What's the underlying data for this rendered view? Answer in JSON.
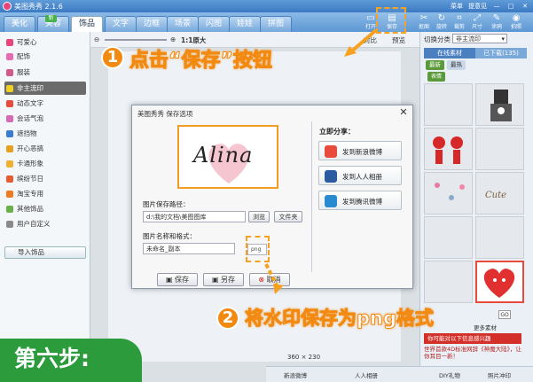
{
  "app": {
    "title": "美图秀秀 2.1.6",
    "top_links": [
      "菜单",
      "提意见"
    ]
  },
  "main_tabs": [
    "美化",
    "美容",
    "饰品",
    "文字",
    "边框",
    "场景",
    "闪图",
    "娃娃",
    "拼图"
  ],
  "main_tabs_active": "饰品",
  "new_badge": "新",
  "toolbar_icons": [
    {
      "label": "打开",
      "icon": "folder-icon"
    },
    {
      "label": "保存",
      "icon": "save-icon"
    },
    {
      "label": "抠图",
      "icon": "cutout-icon"
    },
    {
      "label": "旋转",
      "icon": "rotate-icon"
    },
    {
      "label": "裁剪",
      "icon": "crop-icon"
    },
    {
      "label": "尺寸",
      "icon": "resize-icon"
    },
    {
      "label": "涂鸦",
      "icon": "doodle-icon"
    },
    {
      "label": "拍照",
      "icon": "camera-icon"
    }
  ],
  "left_menu": [
    {
      "label": "可爱心",
      "color": "#e8457a"
    },
    {
      "label": "配饰",
      "color": "#e86ab0"
    },
    {
      "label": "服装",
      "color": "#d05a8a"
    },
    {
      "label": "非主流印",
      "color": "#f0d020"
    },
    {
      "label": "动态文字",
      "color": "#e84a3c"
    },
    {
      "label": "会话气泡",
      "color": "#d76ab4"
    },
    {
      "label": "遮挡物",
      "color": "#3a7bd5"
    },
    {
      "label": "开心恶搞",
      "color": "#e8a020"
    },
    {
      "label": "卡通形象",
      "color": "#f0b030"
    },
    {
      "label": "缤纷节日",
      "color": "#e85a30"
    },
    {
      "label": "淘宝专用",
      "color": "#f07a20"
    },
    {
      "label": "其他饰品",
      "color": "#6ab04a"
    },
    {
      "label": "用户自定义",
      "color": "#8a8a8a"
    }
  ],
  "left_menu_active": "非主流印",
  "import_label": "导入饰品",
  "canvas_toolbar": {
    "zoom": "1:1原大",
    "compare": "对比",
    "fit": "预览"
  },
  "canvas_dims": "360 × 230",
  "right_panel": {
    "category_label": "切换分类",
    "category_value": "非主流印",
    "tab_online": "在线素材",
    "tab_downloaded": "已下载(135)",
    "sub_tabs": [
      "最新",
      "最热"
    ],
    "sub_active": "表情",
    "go_label": "GO",
    "more_label": "更多素材",
    "ad_banner": "你可能对以下信息感兴趣",
    "ad_text": "世界首款4D标准网辞《神魔大陆》，让你耳目一新！"
  },
  "dialog": {
    "title": "美图秀秀 保存选项",
    "preview_text": "Alina",
    "path_label": "图片保存路径：",
    "path_value": "d:\\我的文档\\美图图库",
    "browse_label": "浏览",
    "folder_label": "文件夹",
    "name_label": "图片名称和格式：",
    "name_value": "未命名_副本",
    "format_value": "png",
    "save_label": "保存",
    "saveas_label": "另存",
    "cancel_label": "取消",
    "share_title": "立即分享：",
    "share_buttons": [
      {
        "label": "发到新浪微博",
        "color": "#e84a3c"
      },
      {
        "label": "发到人人相册",
        "color": "#2a5aa0"
      },
      {
        "label": "发到腾讯微博",
        "color": "#2a8ad0"
      }
    ]
  },
  "callout_1": {
    "number": "1",
    "text": "点击“保存”按钮"
  },
  "callout_2": {
    "number": "2",
    "text": "将水印保存为png格式"
  },
  "step_label": "第六步:",
  "statusbar": [
    "新浪微博",
    "人人相册",
    "DIY礼物",
    "照片冲印"
  ],
  "colors": {
    "accent_orange": "#f28a12",
    "step_green": "#2b9b3c",
    "title_blue": "#3b79c2"
  }
}
